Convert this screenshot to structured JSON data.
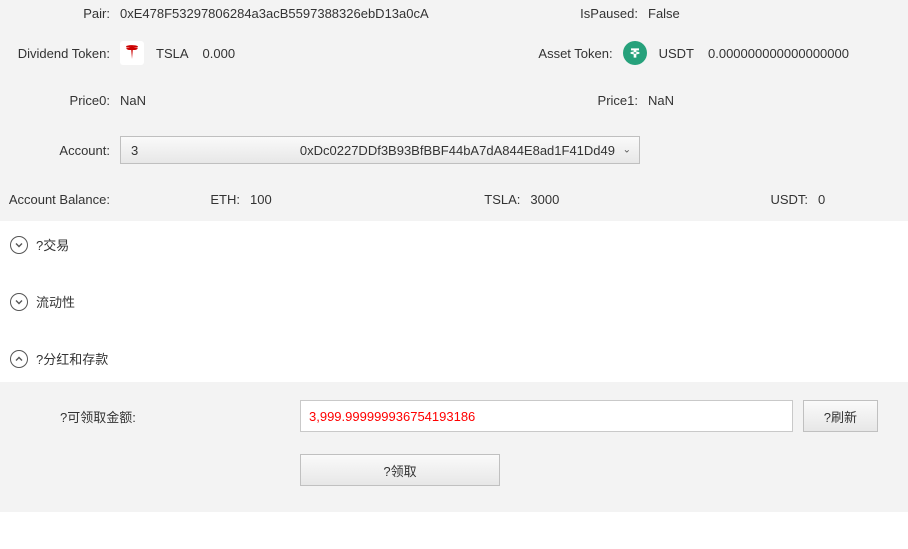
{
  "info": {
    "pair_label": "Pair:",
    "pair_value": "0xE478F53297806284a3acB5597388326ebD13a0cA",
    "isPaused_label": "IsPaused:",
    "isPaused_value": "False",
    "dividendToken_label": "Dividend Token:",
    "dividendToken_symbol": "TSLA",
    "dividendToken_amount": "0.000",
    "assetToken_label": "Asset Token:",
    "assetToken_symbol": "USDT",
    "assetToken_amount": "0.000000000000000000",
    "price0_label": "Price0:",
    "price0_value": "NaN",
    "price1_label": "Price1:",
    "price1_value": "NaN",
    "account_label": "Account:",
    "account_index": "3",
    "account_address": "0xDc0227DDf3B93BfBBF44bA7dA844E8ad1F41Dd49",
    "accountBalance_label": "Account Balance:",
    "eth_label": "ETH:",
    "eth_value": "100",
    "tsla_label": "TSLA:",
    "tsla_value": "3000",
    "usdt_label": "USDT:",
    "usdt_value": "0"
  },
  "sections": {
    "trade": "?交易",
    "liquidity": "流动性",
    "dividend": "?分红和存款"
  },
  "dividend_panel": {
    "claimable_label": "?可领取金额:",
    "claimable_value": "3,999.999999936754193186",
    "refresh_btn": "?刷新",
    "claim_btn": "?领取"
  }
}
